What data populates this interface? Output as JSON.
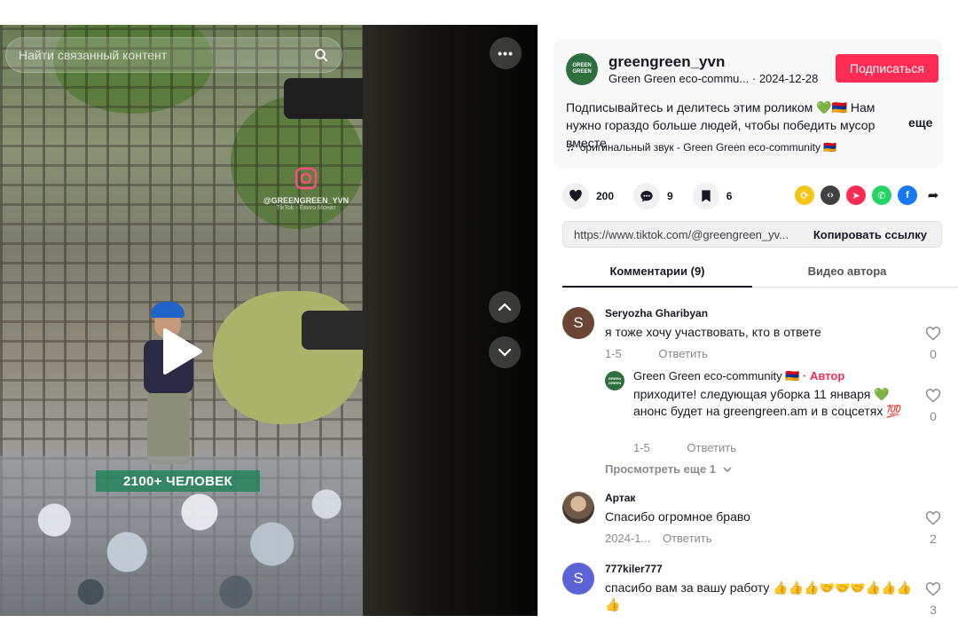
{
  "video": {
    "search_placeholder": "Найти связанный контент",
    "watermark_user": "@GREENGREEN_YVN",
    "watermark_sub": "TikTok · Ёвиго Монат",
    "overlay_caption": "2100+ ЧЕЛОВЕК",
    "more_label": "•••"
  },
  "post": {
    "avatar_text": "GREEN GREEN",
    "username": "greengreen_yvn",
    "display_name": "Green  Green  eco-commu...",
    "date_separator": "·",
    "date": "2024-12-28",
    "follow_label": "Подписаться",
    "description": "Подписывайтесь и делитесь этим роликом 💚🇦🇲 Нам нужно гораздо больше людей, чтобы победить мусор вместе",
    "more_label": "еще",
    "sound": "оригинальный звук - Green  Green  eco-community 🇦🇲"
  },
  "actions": {
    "likes": "200",
    "comments": "9",
    "saves": "6"
  },
  "share": {
    "url": "https://www.tiktok.com/@greengreen_yv...",
    "copy_label": "Копировать ссылку",
    "icons": [
      "repost-icon",
      "embed-icon",
      "send-icon",
      "whatsapp-icon",
      "facebook-icon",
      "share-arrow-icon"
    ]
  },
  "tabs": {
    "comments": "Комментарии (9)",
    "author_videos": "Видео автора"
  },
  "comments": [
    {
      "avatar_letter": "S",
      "avatar_color": "#6a4434",
      "name": "Seryozha Gharibyan",
      "text": "я тоже хочу участвовать, кто в ответе",
      "date": "1-5",
      "reply_label": "Ответить",
      "likes": "0"
    },
    {
      "avatar_letter": "",
      "name": "Артак",
      "text": "Спасибо огромное браво",
      "date": "2024-1...",
      "reply_label": "Ответить",
      "likes": "2"
    },
    {
      "avatar_letter": "S",
      "avatar_color": "#5b63d6",
      "name": "777kiler777",
      "text": "спасибо вам за вашу работу 👍👍👍🤝🤝🤝👍👍👍👍",
      "likes": "3"
    }
  ],
  "reply": {
    "avatar_text": "GREEN GREEN",
    "name": "Green  Green  eco-community 🇦🇲",
    "author_badge": "· Автор",
    "text": "приходите! следующая уборка 11 января 💚 анонс будет на greengreen.am и в соцсетях 💯",
    "date": "1-5",
    "reply_label": "Ответить",
    "likes": "0"
  },
  "view_more": "Просмотреть еще 1",
  "colors": {
    "accent": "#fe2c55",
    "brand_green": "#2e6f3e"
  }
}
